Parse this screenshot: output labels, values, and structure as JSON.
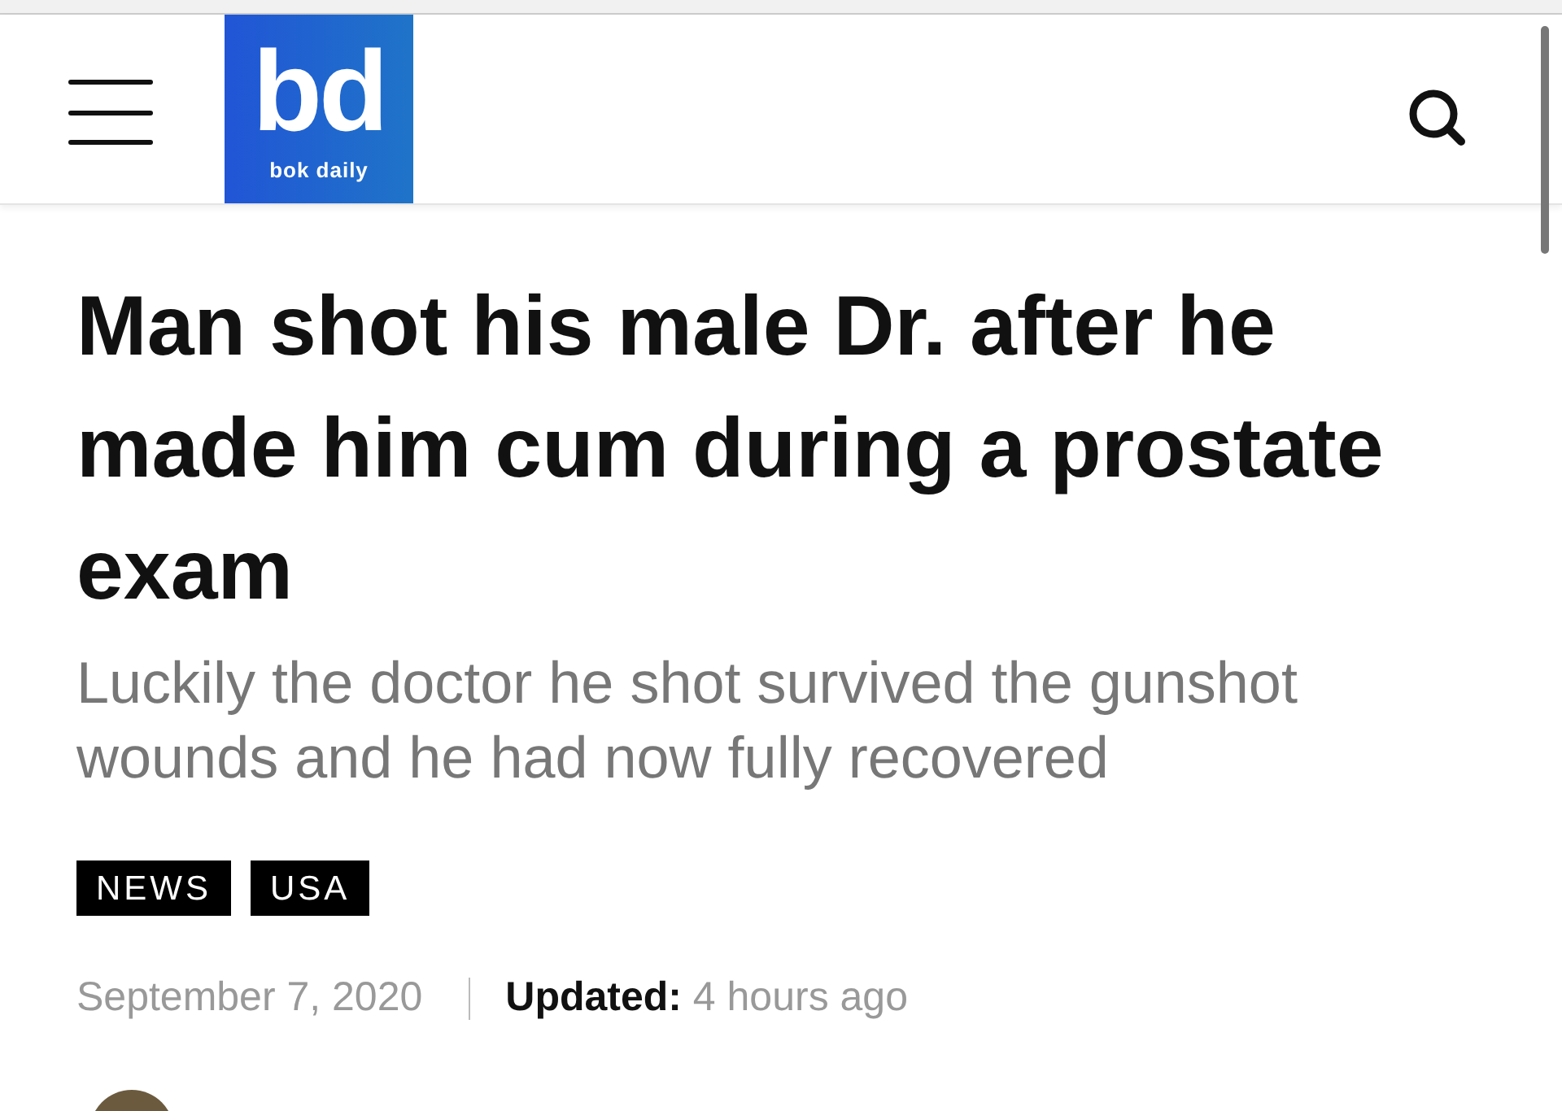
{
  "header": {
    "logo": {
      "mark": "bd",
      "name": "bok daily"
    }
  },
  "article": {
    "title": "Man shot his male Dr. after he made him cum during a prostate exam",
    "subtitle": "Luckily the doctor he shot survived the gunshot wounds and he had now fully recovered",
    "tags": [
      "NEWS",
      "USA"
    ],
    "date": "September 7, 2020",
    "updated": "**Updated:** 4 hours ago"
  }
}
